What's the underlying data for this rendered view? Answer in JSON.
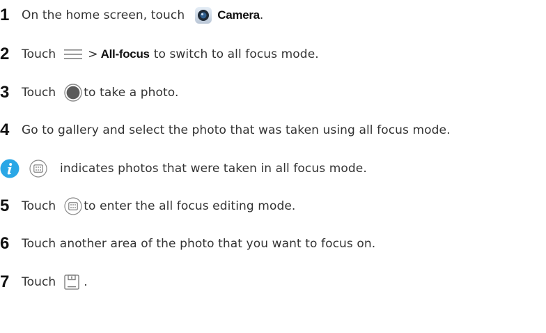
{
  "steps": [
    {
      "number": "1",
      "text_before": "On the home screen, touch",
      "app_name": "Camera",
      "text_after": "."
    },
    {
      "number": "2",
      "text_before": "Touch",
      "separator": ">",
      "option": "All-focus",
      "text_after": "to switch to all focus mode."
    },
    {
      "number": "3",
      "text_before": "Touch",
      "text_after": "to take a photo."
    },
    {
      "number": "4",
      "text": "Go to gallery and select the photo that was taken using all focus mode."
    },
    {
      "number": "5",
      "text_before": "Touch",
      "text_after": "to enter the all focus editing mode."
    },
    {
      "number": "6",
      "text": "Touch another area of the photo that you want to focus on."
    },
    {
      "number": "7",
      "text_before": "Touch",
      "text_after": "."
    }
  ],
  "note": {
    "text": "indicates photos that were taken in all focus mode."
  },
  "icons": {
    "camera": "camera-app-icon",
    "menu": "menu-icon",
    "shutter": "shutter-icon",
    "info": "info-icon",
    "all_focus": "all-focus-icon",
    "save": "save-icon"
  },
  "colors": {
    "info_blue": "#2aa7e6",
    "text": "#333333",
    "shutter_grey": "#5a5a5a"
  }
}
